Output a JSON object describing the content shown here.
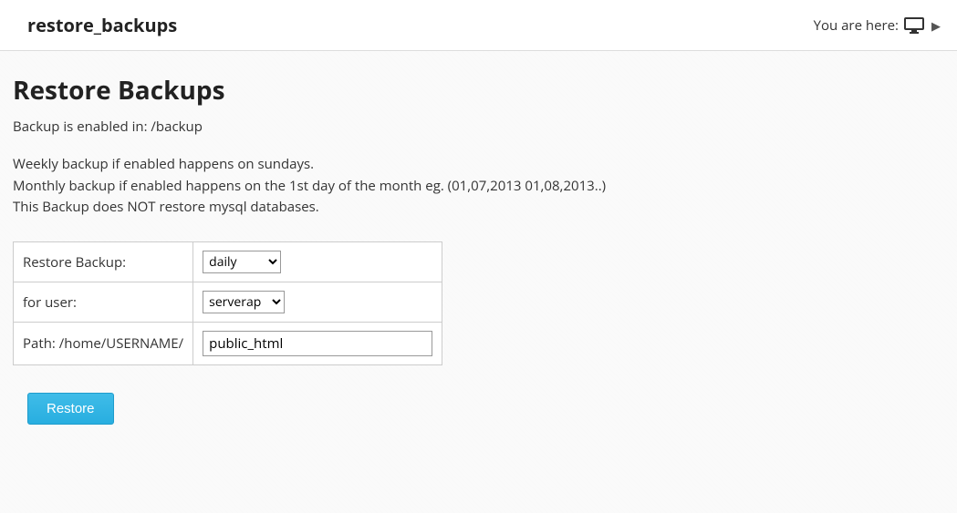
{
  "topbar": {
    "title": "restore_backups",
    "breadcrumb_label": "You are here:"
  },
  "page": {
    "heading": "Restore Backups",
    "info_line1": "Backup is enabled in: /backup",
    "info_line2": "Weekly backup if enabled happens on sundays.",
    "info_line3": "Monthly backup if enabled happens on the 1st day of the month eg. (01,07,2013 01,08,2013..)",
    "info_line4": "This Backup does NOT restore mysql databases."
  },
  "form": {
    "row_backup_label": "Restore Backup:",
    "row_user_label": "for user:",
    "row_path_label": "Path: /home/USERNAME/",
    "frequency_selected": "daily",
    "user_selected": "serverap",
    "path_value": "public_html",
    "submit_label": "Restore"
  }
}
